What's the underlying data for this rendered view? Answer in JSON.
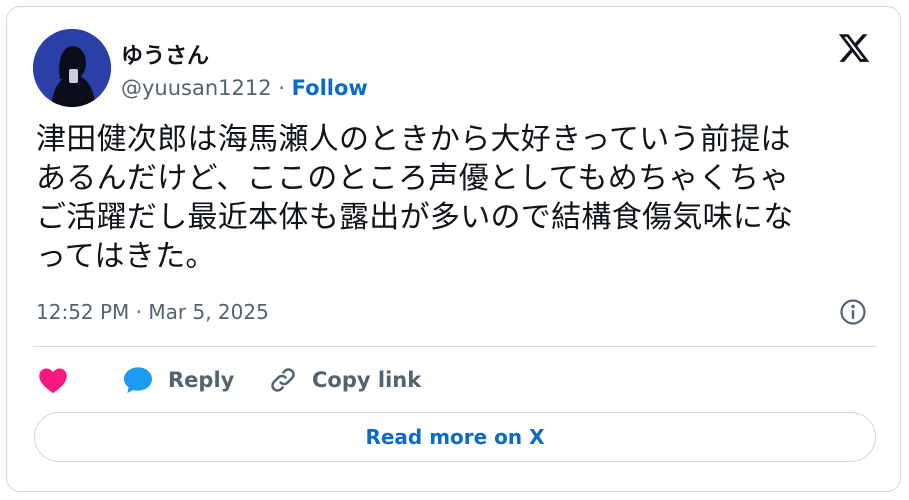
{
  "author": {
    "display_name": "ゆうさん",
    "handle": "@yuusan1212",
    "separator": "·",
    "follow_label": "Follow"
  },
  "tweet": {
    "lines": [
      "津田健次郎は海馬瀬人のときから大好きっていう前提は",
      "あるんだけど、ここのところ声優としてもめちゃくちゃ",
      "ご活躍だし最近本体も露出が多いので結構食傷気味にな",
      "ってはきた。"
    ],
    "timestamp": "12:52 PM · Mar 5, 2025"
  },
  "actions": {
    "like_icon": "heart-icon",
    "reply_icon": "speech-bubble-icon",
    "reply_label": "Reply",
    "copy_icon": "link-icon",
    "copy_label": "Copy link"
  },
  "read_more_label": "Read more on X",
  "icons": {
    "brand": "x-logo-icon",
    "info": "info-icon"
  },
  "colors": {
    "accent": "#0b6bc6",
    "heart": "#f91880",
    "reply_bubble": "#1d9bf0",
    "avatar_bg": "#2a3fa8"
  }
}
